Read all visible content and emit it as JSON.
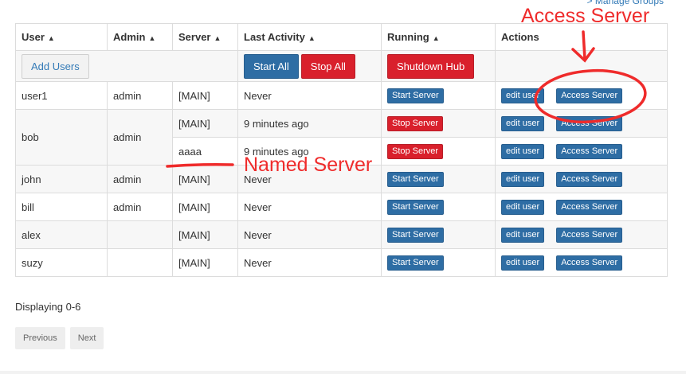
{
  "header": {
    "manage_groups_link": "> Manage Groups"
  },
  "columns": [
    "User",
    "Admin",
    "Server",
    "Last Activity",
    "Running",
    "Actions"
  ],
  "controls": {
    "add_users": "Add Users",
    "start_all": "Start All",
    "stop_all": "Stop All",
    "shutdown_hub": "Shutdown Hub"
  },
  "rows": [
    {
      "user": "user1",
      "admin": "admin",
      "server": "[MAIN]",
      "last_activity": "Never",
      "running_label": "Start Server",
      "edit": "edit user",
      "access": "Access Server"
    },
    {
      "user": "bob",
      "admin": "admin",
      "server": "[MAIN]",
      "last_activity": "9 minutes ago",
      "running_label": "Stop Server",
      "edit": "edit user",
      "access": "Access Server"
    },
    {
      "user": "",
      "admin": "",
      "server": "aaaa",
      "last_activity": "9 minutes ago",
      "running_label": "Stop Server",
      "edit": "edit user",
      "access": "Access Server"
    },
    {
      "user": "john",
      "admin": "admin",
      "server": "[MAIN]",
      "last_activity": "Never",
      "running_label": "Start Server",
      "edit": "edit user",
      "access": "Access Server"
    },
    {
      "user": "bill",
      "admin": "admin",
      "server": "[MAIN]",
      "last_activity": "Never",
      "running_label": "Start Server",
      "edit": "edit user",
      "access": "Access Server"
    },
    {
      "user": "alex",
      "admin": "",
      "server": "[MAIN]",
      "last_activity": "Never",
      "running_label": "Start Server",
      "edit": "edit user",
      "access": "Access Server"
    },
    {
      "user": "suzy",
      "admin": "",
      "server": "[MAIN]",
      "last_activity": "Never",
      "running_label": "Start Server",
      "edit": "edit user",
      "access": "Access Server"
    }
  ],
  "footer": {
    "displaying": "Displaying 0-6",
    "previous": "Previous",
    "next": "Next"
  },
  "annotations": {
    "access_server": "Access Server",
    "named_server": "Named Server",
    "color": "#ef2b2b"
  },
  "colors": {
    "primary": "#2e6da4",
    "danger": "#d9202c",
    "link": "#337ab7"
  }
}
